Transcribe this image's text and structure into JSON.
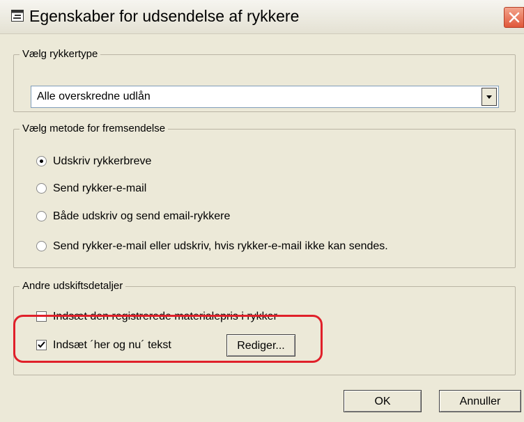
{
  "window": {
    "title": "Egenskaber for udsendelse af rykkere",
    "close_icon": "close-icon",
    "title_icon": "window-icon"
  },
  "reminder_type": {
    "legend": "Vælg rykkertype",
    "selected": "Alle overskredne udlån"
  },
  "send_method": {
    "legend": "Vælg metode for fremsendelse",
    "options": [
      {
        "label": "Udskriv rykkerbreve",
        "selected": true
      },
      {
        "label": "Send rykker-e-mail",
        "selected": false
      },
      {
        "label": "Både udskriv og send email-rykkere",
        "selected": false
      },
      {
        "label": "Send rykker-e-mail eller udskriv, hvis rykker-e-mail ikke kan sendes.",
        "selected": false
      }
    ]
  },
  "print_details": {
    "legend": "Andre udskiftsdetaljer",
    "price_checkbox": {
      "label": "Indsæt den registrerede materialepris i rykker",
      "checked": false
    },
    "text_checkbox": {
      "label": "Indsæt ´her og nu´ tekst",
      "checked": true
    },
    "edit_button": "Rediger..."
  },
  "footer": {
    "ok_button": "OK",
    "cancel_button": "Annuller"
  },
  "colors": {
    "dialog_bg": "#ece9d8",
    "highlight": "#e0202a"
  }
}
